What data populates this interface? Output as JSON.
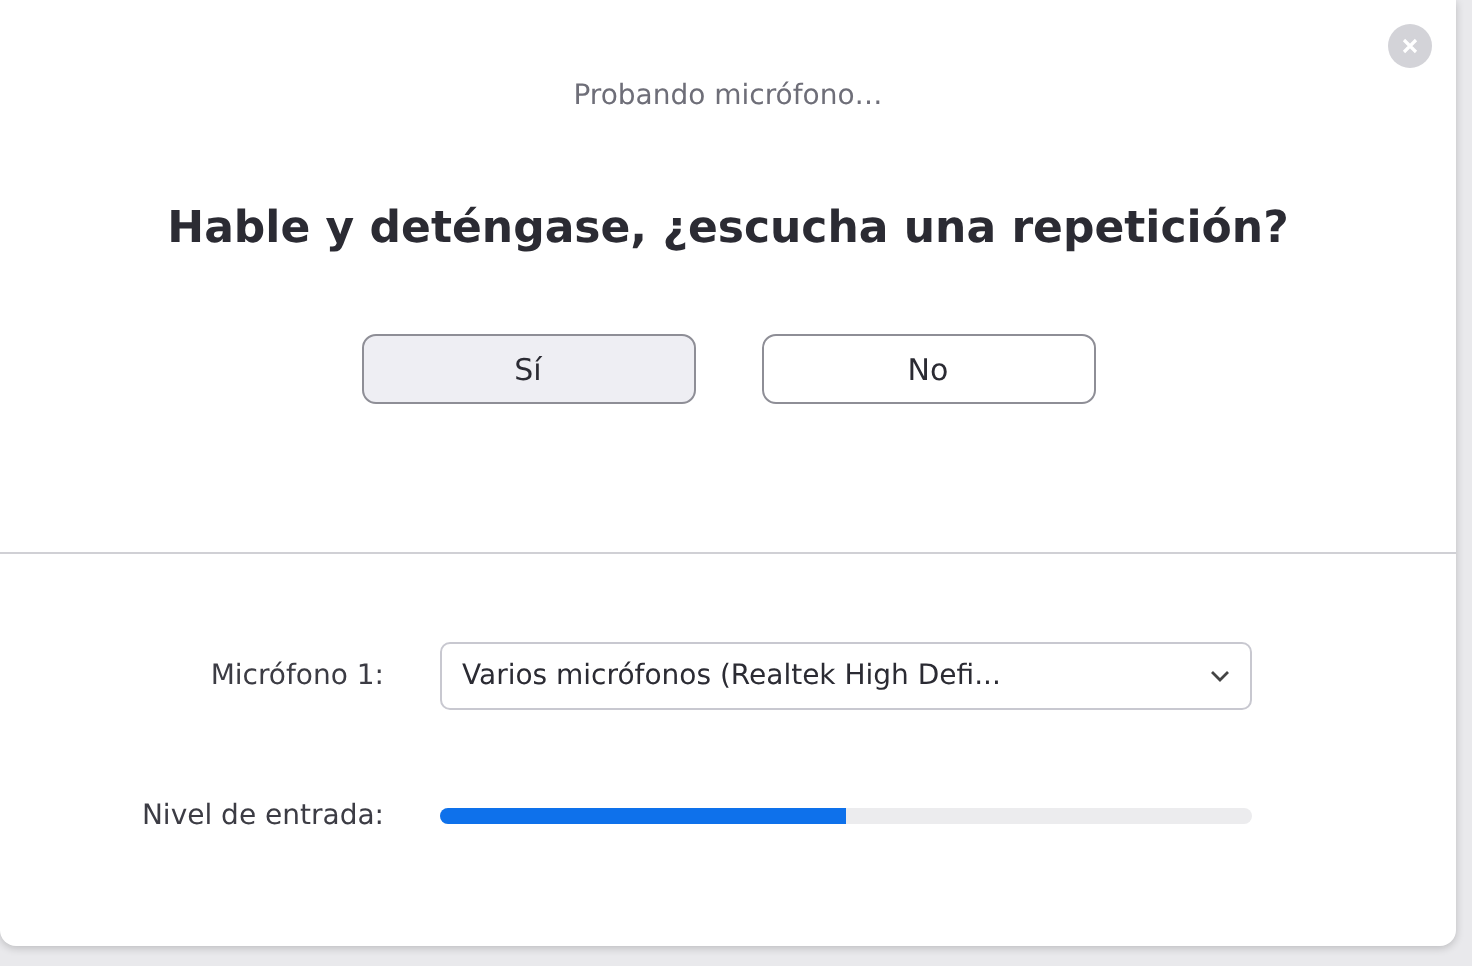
{
  "dialog": {
    "title": "Probando micrófono…",
    "question": "Hable y deténgase, ¿escucha una repetición?",
    "buttons": [
      {
        "label": "Sí",
        "selected": true
      },
      {
        "label": "No",
        "selected": false
      }
    ],
    "microphone": {
      "label": "Micrófono 1:",
      "value": "Varios micrófonos (Realtek High Defi..."
    },
    "input_level": {
      "label": "Nivel de entrada:",
      "level": 0.5
    }
  }
}
